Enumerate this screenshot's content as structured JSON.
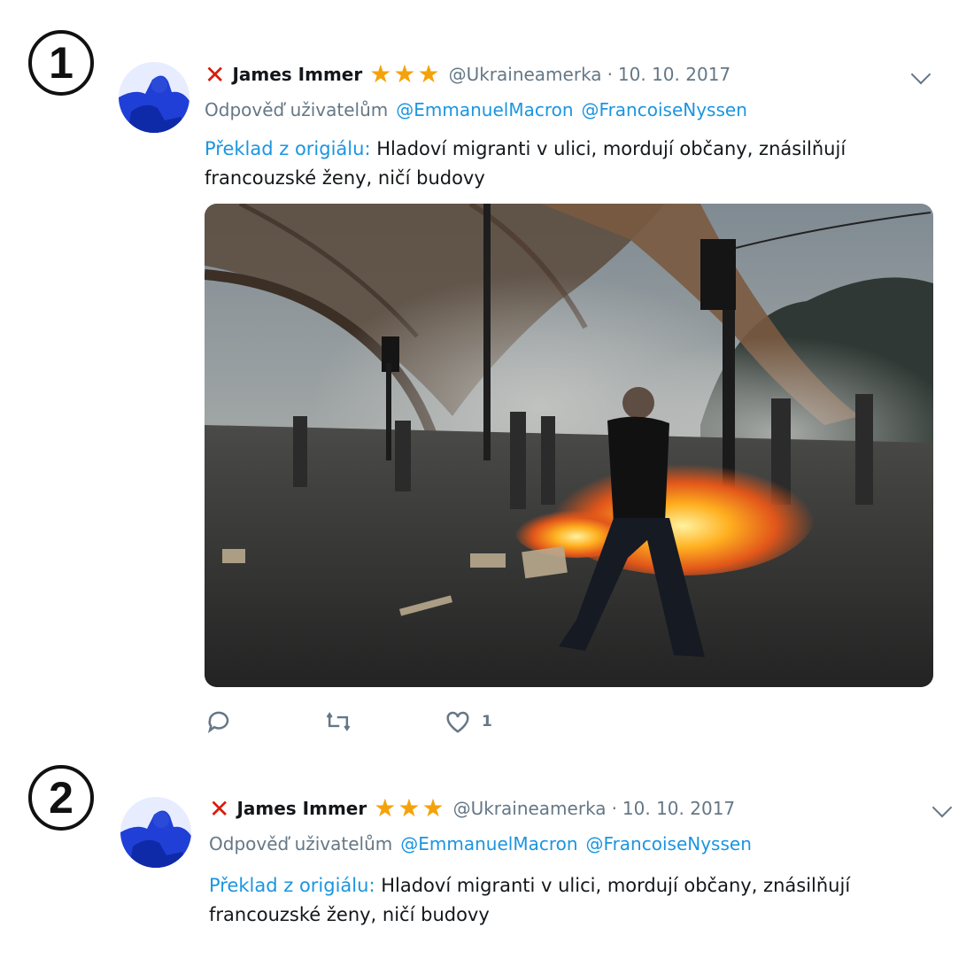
{
  "markers": [
    "1",
    "2"
  ],
  "tweets": [
    {
      "display_name": "James Immer",
      "handle": "@Ukraineamerka",
      "date": "10. 10. 2017",
      "reply_prefix": "Odpověď uživatelům",
      "mentions": [
        "@EmmanuelMacron",
        "@FrancoiseNyssen"
      ],
      "translation_label": "Překlad z origiálu:",
      "text_line1": "Hladoví migranti v ulici, mordují občany, znásilňují",
      "text_line2": "francouzské ženy, ničí budovy",
      "like_count": "1"
    },
    {
      "display_name": "James Immer",
      "handle": "@Ukraineamerka",
      "date": "10. 10. 2017",
      "reply_prefix": "Odpověď uživatelům",
      "mentions": [
        "@EmmanuelMacron",
        "@FrancoiseNyssen"
      ],
      "translation_label": "Překlad z origiálu:",
      "text_line1": "Hladoví migranti v ulici, mordují občany, znásilňují",
      "text_line2": "francouzské ženy, ničí budovy"
    }
  ],
  "icons": {
    "verified_mark": "x-mark-icon",
    "rating": "star-icon",
    "menu": "chevron-down-icon",
    "reply": "reply-icon",
    "retweet": "retweet-icon",
    "like": "heart-icon"
  },
  "colors": {
    "mention": "#1b95e0",
    "muted": "#657786",
    "x_mark": "#d81b0d",
    "star": "#f5a20a"
  },
  "separator": "·"
}
